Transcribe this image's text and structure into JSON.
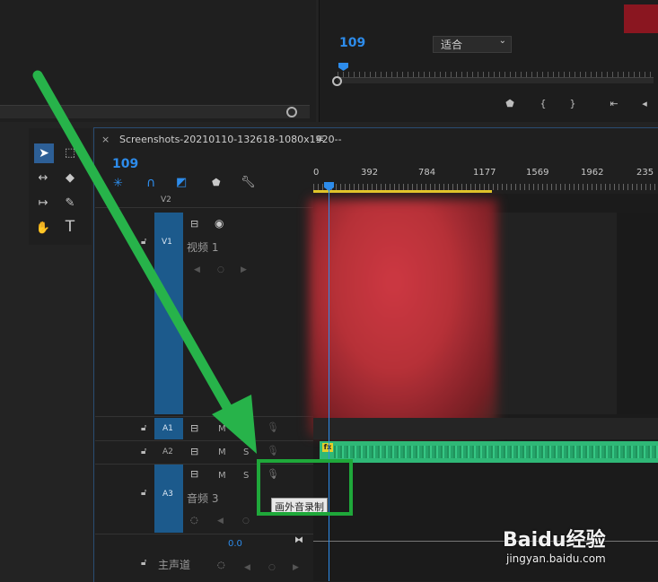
{
  "source_monitor": {
    "timecode": "109",
    "fit_select": "适合"
  },
  "timeline": {
    "sequence_tab": "Screenshots-20210110-132618-1080x1920--",
    "menu_icon": "≡",
    "close_icon": "×",
    "timecode": "109",
    "ruler_ticks": [
      "0",
      "392",
      "784",
      "1177",
      "1569",
      "1962",
      "235"
    ],
    "fx_badge": "fx"
  },
  "tracks": {
    "v2_label": "V2",
    "v1_label": "V1",
    "v1_name": "视频 1",
    "a1_label": "A1",
    "a2_label": "A2",
    "a3_label": "A3",
    "a3_name": "音频 3",
    "m": "M",
    "s": "S",
    "master_value": "0.0",
    "master_name": "主声道"
  },
  "tooltip": "画外音录制",
  "watermark": {
    "brand": "Baidu经验",
    "url": "jingyan.baidu.com"
  },
  "colors": {
    "accent_blue": "#2d8ceb",
    "track_blue": "#1c5a8c",
    "audio_green": "#2fb877",
    "highlight_green": "#1fa83a",
    "arrow_green": "#27b34a"
  }
}
